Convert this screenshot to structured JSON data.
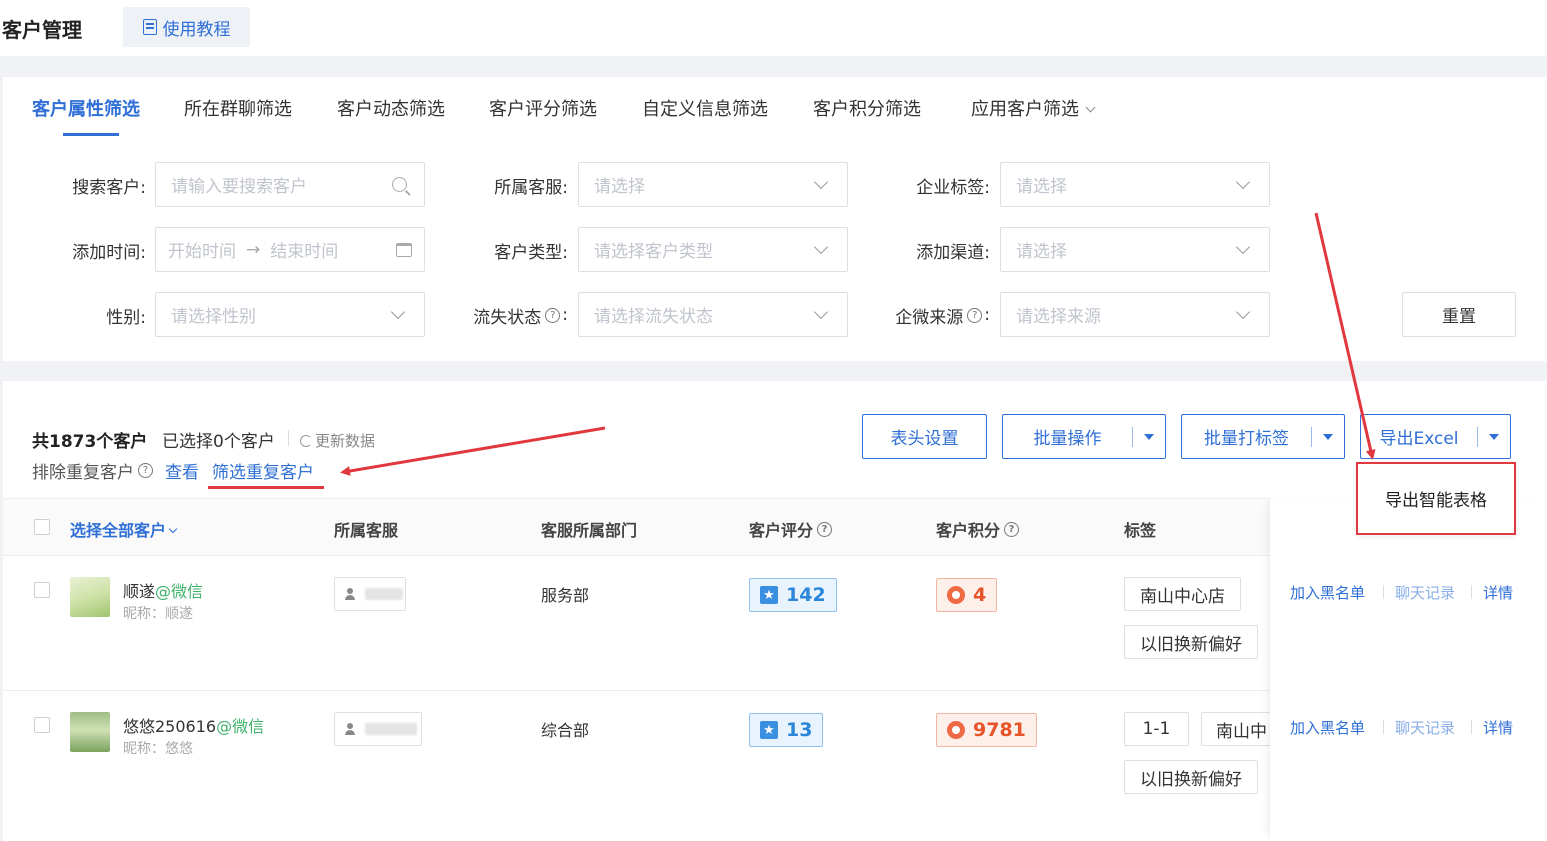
{
  "header": {
    "title": "客户管理",
    "tutorial_label": "使用教程"
  },
  "tabs": [
    {
      "label": "客户属性筛选",
      "active": true
    },
    {
      "label": "所在群聊筛选"
    },
    {
      "label": "客户动态筛选"
    },
    {
      "label": "客户评分筛选"
    },
    {
      "label": "自定义信息筛选"
    },
    {
      "label": "客户积分筛选"
    },
    {
      "label": "应用客户筛选"
    }
  ],
  "filters": {
    "search_customer": {
      "label": "搜索客户:",
      "placeholder": "请输入要搜索客户"
    },
    "agent": {
      "label": "所属客服:",
      "placeholder": "请选择"
    },
    "corp_tag": {
      "label": "企业标签:",
      "placeholder": "请选择"
    },
    "add_time": {
      "label": "添加时间:",
      "start": "开始时间",
      "arrow": "→",
      "end": "结束时间"
    },
    "customer_type": {
      "label": "客户类型:",
      "placeholder": "请选择客户类型"
    },
    "add_channel": {
      "label": "添加渠道:",
      "placeholder": "请选择"
    },
    "gender": {
      "label": "性别:",
      "placeholder": "请选择性别"
    },
    "churn_status": {
      "label": "流失状态",
      "colon": ":",
      "placeholder": "请选择流失状态"
    },
    "wecom_source": {
      "label": "企微来源",
      "colon": ":",
      "placeholder": "请选择来源"
    },
    "reset_label": "重置"
  },
  "summary": {
    "total": "共1873个客户",
    "selected": "已选择0个客户",
    "refresh": "更新数据",
    "dedup_label": "排除重复客户",
    "view_link": "查看",
    "filter_dup_link": "筛选重复客户"
  },
  "actions": {
    "header_settings": "表头设置",
    "batch_ops": "批量操作",
    "batch_tag": "批量打标签",
    "export_excel": "导出Excel",
    "export_menu_item": "导出智能表格"
  },
  "table": {
    "columns": {
      "select_all": "选择全部客户",
      "agent": "所属客服",
      "dept": "客服所属部门",
      "score": "客户评分",
      "points": "客户积分",
      "tags": "标签"
    },
    "rows": [
      {
        "name": "顺遂",
        "source": "@微信",
        "nickname": "昵称：顺遂",
        "dept": "服务部",
        "score": "142",
        "points": "4",
        "tags": [
          "南山中心店",
          "以旧换新偏好"
        ],
        "ops": [
          "加入黑名单",
          "聊天记录",
          "详情"
        ]
      },
      {
        "name": "悠悠250616",
        "source": "@微信",
        "nickname": "昵称：悠悠",
        "dept": "综合部",
        "score": "13",
        "points": "9781",
        "tags": [
          "1-1",
          "南山中",
          "以旧换新偏好"
        ],
        "ops": [
          "加入黑名单",
          "聊天记录",
          "详情"
        ]
      }
    ]
  },
  "colors": {
    "accent": "#2f6fd6",
    "annotation_red": "#e0383e",
    "wechat_green": "#3fb26b"
  }
}
